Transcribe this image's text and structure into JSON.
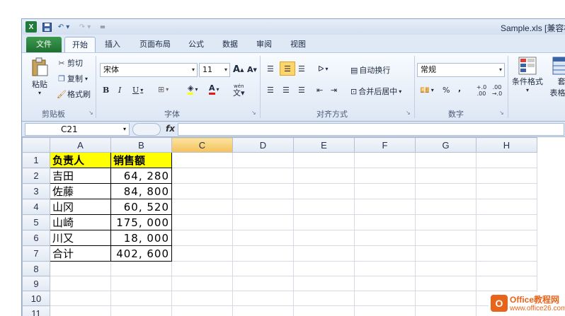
{
  "window": {
    "title": "Sample.xls [兼容模"
  },
  "qat": {
    "app_icon": "X",
    "save_icon": "floppy-disk",
    "undo": "↶ ▾",
    "redo": "↷ ▾",
    "more": "="
  },
  "tabs": [
    {
      "label": "文件"
    },
    {
      "label": "开始"
    },
    {
      "label": "插入"
    },
    {
      "label": "页面布局"
    },
    {
      "label": "公式"
    },
    {
      "label": "数据"
    },
    {
      "label": "审阅"
    },
    {
      "label": "视图"
    }
  ],
  "clipboard": {
    "paste": "粘贴",
    "cut": "剪切",
    "copy": "复制",
    "format_painter": "格式刷",
    "group": "剪贴板"
  },
  "font": {
    "name": "宋体",
    "size": "11",
    "grow": "A",
    "shrink": "A",
    "bold": "B",
    "italic": "I",
    "underline": "U",
    "group": "字体",
    "pinyin": "wén"
  },
  "alignment": {
    "wrap": "自动换行",
    "merge": "合并后居中",
    "group": "对齐方式"
  },
  "number": {
    "format": "常规",
    "percent": "%",
    "comma": ",",
    "inc": "+.0 .00",
    "dec": ".00 →.0",
    "group": "数字"
  },
  "styles": {
    "conditional": "条件格式",
    "table_line1": "套",
    "table_line2": "表格格"
  },
  "formula_bar": {
    "name_box": "C21",
    "fx": "fx",
    "value": ""
  },
  "columns": [
    "A",
    "B",
    "C",
    "D",
    "E",
    "F",
    "G",
    "H"
  ],
  "rows": [
    {
      "n": "1",
      "a": "负责人",
      "b": "销售额"
    },
    {
      "n": "2",
      "a": "吉田",
      "b": "64, 280"
    },
    {
      "n": "3",
      "a": "佐藤",
      "b": "84, 800"
    },
    {
      "n": "4",
      "a": "山冈",
      "b": "60, 520"
    },
    {
      "n": "5",
      "a": "山崎",
      "b": "175, 000"
    },
    {
      "n": "6",
      "a": "川又",
      "b": "18, 000"
    },
    {
      "n": "7",
      "a": "合计",
      "b": "402, 600"
    },
    {
      "n": "8",
      "a": "",
      "b": ""
    },
    {
      "n": "9",
      "a": "",
      "b": ""
    },
    {
      "n": "10",
      "a": "",
      "b": ""
    },
    {
      "n": "11",
      "a": "",
      "b": ""
    }
  ],
  "watermark": {
    "name": "Office教程网",
    "url": "www.office26.com",
    "logo": "O"
  }
}
